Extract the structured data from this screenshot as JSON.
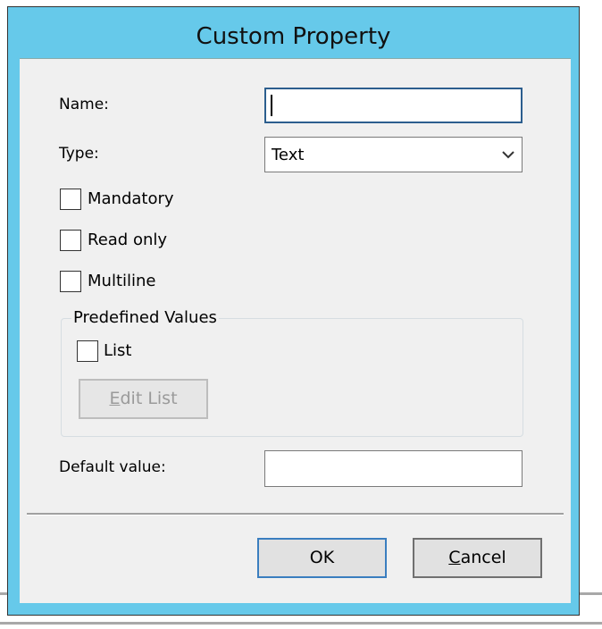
{
  "dialog": {
    "title": "Custom Property"
  },
  "form": {
    "name_label": "Name:",
    "name_value": "",
    "type_label": "Type:",
    "type_value": "Text",
    "mandatory_label": "Mandatory",
    "mandatory_checked": false,
    "readonly_label": "Read only",
    "readonly_checked": false,
    "multiline_label": "Multiline",
    "multiline_checked": false,
    "group_title": "Predefined Values",
    "list_label": "List",
    "list_checked": false,
    "edit_list_label": "Edit List",
    "edit_list_mnemonic": "E",
    "edit_list_rest": "dit List",
    "default_label": "Default value:",
    "default_value": ""
  },
  "buttons": {
    "ok": "OK",
    "cancel": "Cancel",
    "cancel_mnemonic": "C",
    "cancel_rest": "ancel"
  },
  "colors": {
    "titlebar": "#66c9ea",
    "client": "#f0f0f0",
    "focus": "#2c5e8e"
  }
}
